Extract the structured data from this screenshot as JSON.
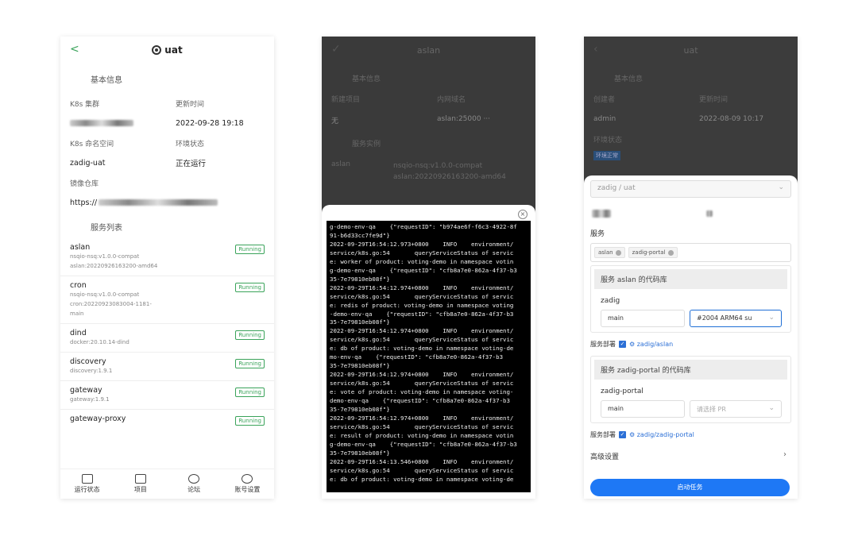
{
  "phone1": {
    "title": "uat",
    "back": "<",
    "basic_info": "基本信息",
    "fields": [
      {
        "label": "K8s 集群",
        "value": ""
      },
      {
        "label": "更新时间",
        "value": "2022-09-28 19:18"
      },
      {
        "label": "K8s 命名空间",
        "value": "zadig-uat"
      },
      {
        "label": "环境状态",
        "value": "正在运行"
      }
    ],
    "registry_label": "镜像仓库",
    "registry_value": "https://",
    "service_list": "服务列表",
    "services": [
      {
        "name": "aslan",
        "meta": [
          "nsqio-nsq:v1.0.0-compat",
          "aslan:20220926163200-amd64"
        ],
        "status": "Running"
      },
      {
        "name": "cron",
        "meta": [
          "nsqio-nsq:v1.0.0-compat",
          "cron:20220923083004-1181-",
          "main"
        ],
        "status": "Running"
      },
      {
        "name": "dind",
        "meta": [
          "docker:20.10.14-dind"
        ],
        "status": "Running"
      },
      {
        "name": "discovery",
        "meta": [
          "discovery:1.9.1"
        ],
        "status": "Running"
      },
      {
        "name": "gateway",
        "meta": [
          "gateway:1.9.1"
        ],
        "status": "Running"
      },
      {
        "name": "gateway-proxy",
        "meta": [],
        "status": "Running"
      }
    ],
    "tabs": [
      "运行状态",
      "项目",
      "论坛",
      "账号设置"
    ]
  },
  "phone2": {
    "title": "aslan",
    "basic_info": "基本信息",
    "label_a": "新建项目",
    "label_b": "内网域名",
    "val_a": "无",
    "val_b": "aslan:25000 ···",
    "containers_label": "服务实例",
    "container_name": "aslan",
    "container_images": [
      "nsqio-nsq:v1.0.0-compat",
      "aslan:20220926163200-amd64"
    ],
    "close": "×",
    "log_lines": [
      "g-demo-env-qa    {\"requestID\": \"b974ae6f-f6c3-4922-8f",
      "91-b6d33cc7fe9d\"}",
      "2022-09-29T16:54:12.973+0800    INFO    environment/",
      "service/k8s.go:54       queryServiceStatus of servic",
      "e: worker of product: voting-demo in namespace votin",
      "g-demo-env-qa    {\"requestID\": \"cfb8a7e0-862a-4f37-b3",
      "35-7e79810eb08f\"}",
      "2022-09-29T16:54:12.974+0800    INFO    environment/",
      "service/k8s.go:54       queryServiceStatus of servic",
      "e: redis of product: voting-demo in namespace voting",
      "-demo-env-qa    {\"requestID\": \"cfb8a7e0-862a-4f37-b3",
      "35-7e79810eb08f\"}",
      "2022-09-29T16:54:12.974+0800    INFO    environment/",
      "service/k8s.go:54       queryServiceStatus of servic",
      "e: db of product: voting-demo in namespace voting-de",
      "mo-env-qa    {\"requestID\": \"cfb8a7e0-862a-4f37-b3",
      "35-7e79810eb08f\"}",
      "2022-09-29T16:54:12.974+0800    INFO    environment/",
      "service/k8s.go:54       queryServiceStatus of servic",
      "e: vote of product: voting-demo in namespace voting-",
      "demo-env-qa    {\"requestID\": \"cfb8a7e0-862a-4f37-b3",
      "35-7e79810eb08f\"}",
      "2022-09-29T16:54:12.974+0800    INFO    environment/",
      "service/k8s.go:54       queryServiceStatus of servic",
      "e: result of product: voting-demo in namespace votin",
      "g-demo-env-qa    {\"requestID\": \"cfb8a7e0-862a-4f37-b3",
      "35-7e79810eb08f\"}",
      "2022-09-29T16:54:13.546+0800    INFO    environment/",
      "service/k8s.go:54       queryServiceStatus of servic",
      "e: db of product: voting-demo in namespace voting-de"
    ]
  },
  "phone3": {
    "title": "uat",
    "basic_info": "基本信息",
    "label_a": "创建者",
    "label_b": "更新时间",
    "val_a": "admin",
    "val_b": "2022-08-09 10:17",
    "status_label": "环境状态",
    "status_badge": "环境正常",
    "env_select": "zadig / uat",
    "services_label": "服务",
    "service_tags": [
      "aslan",
      "zadig-portal"
    ],
    "repo_cards": [
      {
        "header": "服务 aslan 的代码库",
        "repo": "zadig",
        "branch": "main",
        "pr": "#2004 ARM64 su",
        "deploy_label": "服务部署",
        "deploy_link": "zadig/aslan"
      },
      {
        "header": "服务 zadig-portal 的代码库",
        "repo": "zadig-portal",
        "branch": "main",
        "pr": "请选择 PR",
        "deploy_label": "服务部署",
        "deploy_link": "zadig/zadig-portal"
      }
    ],
    "advanced": "高级设置",
    "start": "启动任务"
  }
}
